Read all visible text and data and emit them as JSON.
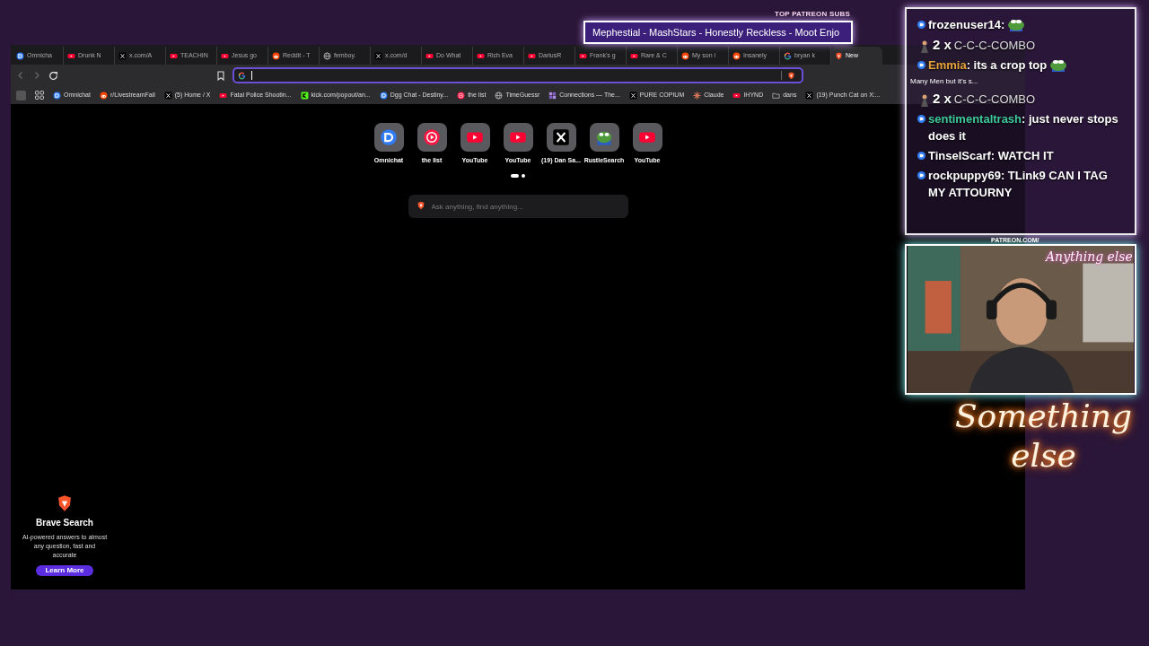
{
  "tabs": [
    {
      "label": "Omnicha",
      "kind": "omnichat",
      "selected": false
    },
    {
      "label": "Drunk N",
      "kind": "youtube",
      "selected": false
    },
    {
      "label": "x.com/A",
      "kind": "x",
      "selected": false
    },
    {
      "label": "TEACHIN",
      "kind": "youtube",
      "selected": false
    },
    {
      "label": "Jesus go",
      "kind": "youtube",
      "selected": false
    },
    {
      "label": "Reddit - T",
      "kind": "reddit",
      "selected": false
    },
    {
      "label": "femboy.",
      "kind": "globe",
      "selected": false
    },
    {
      "label": "x.com/d",
      "kind": "x",
      "selected": false
    },
    {
      "label": "Do What",
      "kind": "youtube",
      "selected": false
    },
    {
      "label": "Rich Eva",
      "kind": "youtube",
      "selected": false
    },
    {
      "label": "DariusR",
      "kind": "youtube",
      "selected": false
    },
    {
      "label": "Frank's g",
      "kind": "youtube",
      "selected": false
    },
    {
      "label": "Rare & C",
      "kind": "youtube",
      "selected": false
    },
    {
      "label": "My son i",
      "kind": "reddit",
      "selected": false
    },
    {
      "label": "Insanely",
      "kind": "reddit",
      "selected": false
    },
    {
      "label": "bryan k",
      "kind": "google",
      "selected": false
    },
    {
      "label": "New",
      "kind": "brave",
      "selected": true
    }
  ],
  "bookmarks": [
    {
      "label": "Omnichat",
      "kind": "omnichat"
    },
    {
      "label": "r/LivestreamFail",
      "kind": "reddit"
    },
    {
      "label": "(5) Home / X",
      "kind": "x"
    },
    {
      "label": "Fatal Police Shootin...",
      "kind": "youtube"
    },
    {
      "label": "kick.com/popout/an...",
      "kind": "kick"
    },
    {
      "label": "Dgg Chat - Destiny...",
      "kind": "omnichat"
    },
    {
      "label": "the list",
      "kind": "list"
    },
    {
      "label": "TimeGuessr",
      "kind": "globe"
    },
    {
      "label": "Connections — The...",
      "kind": "connections"
    },
    {
      "label": "PURE COPIUM",
      "kind": "x"
    },
    {
      "label": "Claude",
      "kind": "claude"
    },
    {
      "label": "IHYND",
      "kind": "youtube"
    },
    {
      "label": "dans",
      "kind": "folder"
    },
    {
      "label": "(19) Punch Cat on X:...",
      "kind": "x"
    }
  ],
  "new_tab": {
    "shortcuts": [
      {
        "label": "Omnichat",
        "kind": "omnichat"
      },
      {
        "label": "the list",
        "kind": "list"
      },
      {
        "label": "YouTube",
        "kind": "youtube"
      },
      {
        "label": "YouTube",
        "kind": "youtube"
      },
      {
        "label": "(19) Dan Sa...",
        "kind": "x"
      },
      {
        "label": "RustleSearch",
        "kind": "frog"
      },
      {
        "label": "YouTube",
        "kind": "youtube"
      }
    ],
    "pager": [
      {
        "selected": true
      },
      {
        "selected": false
      }
    ],
    "search": {
      "placeholder": "Ask anything, find anything..."
    },
    "promo": {
      "title": "Brave Search",
      "text": "AI-powered answers to almost any question, fast and accurate",
      "button": "Learn More"
    }
  },
  "overlay": {
    "top_subs": {
      "title": "TOP PATREON SUBS",
      "ticker": "Mephestial - MashStars - Honestly Reckless - Moot Enjo"
    },
    "chat": [
      {
        "kind": "message",
        "user": "frozenuser14",
        "color": "#ffffff",
        "text": ":",
        "emote": true
      },
      {
        "kind": "combo",
        "count": "2 x",
        "text": "C-C-C-COMBO"
      },
      {
        "kind": "message",
        "user": "Emmia",
        "color": "#e8a33a",
        "text": ": its a crop top",
        "emote": true
      },
      {
        "kind": "combo",
        "count": "2 x",
        "text": "C-C-C-COMBO"
      },
      {
        "kind": "message",
        "user": "sentimentaltrash",
        "color": "#3fc99a",
        "text": ": just never stops does it",
        "emote": false
      },
      {
        "kind": "message",
        "user": "TinselScarf",
        "color": "#ffffff",
        "text": ": WATCH IT",
        "emote": false
      },
      {
        "kind": "message",
        "user": "rockpuppy69",
        "color": "#ffffff",
        "text": ": TLink9 CAN I TAG MY ATTOURNY",
        "emote": false
      }
    ],
    "popup": "Many Men but it's s...",
    "patreon_label": "PATREON.COM/",
    "signature": "Anything else",
    "neon_sign": "Something else"
  }
}
